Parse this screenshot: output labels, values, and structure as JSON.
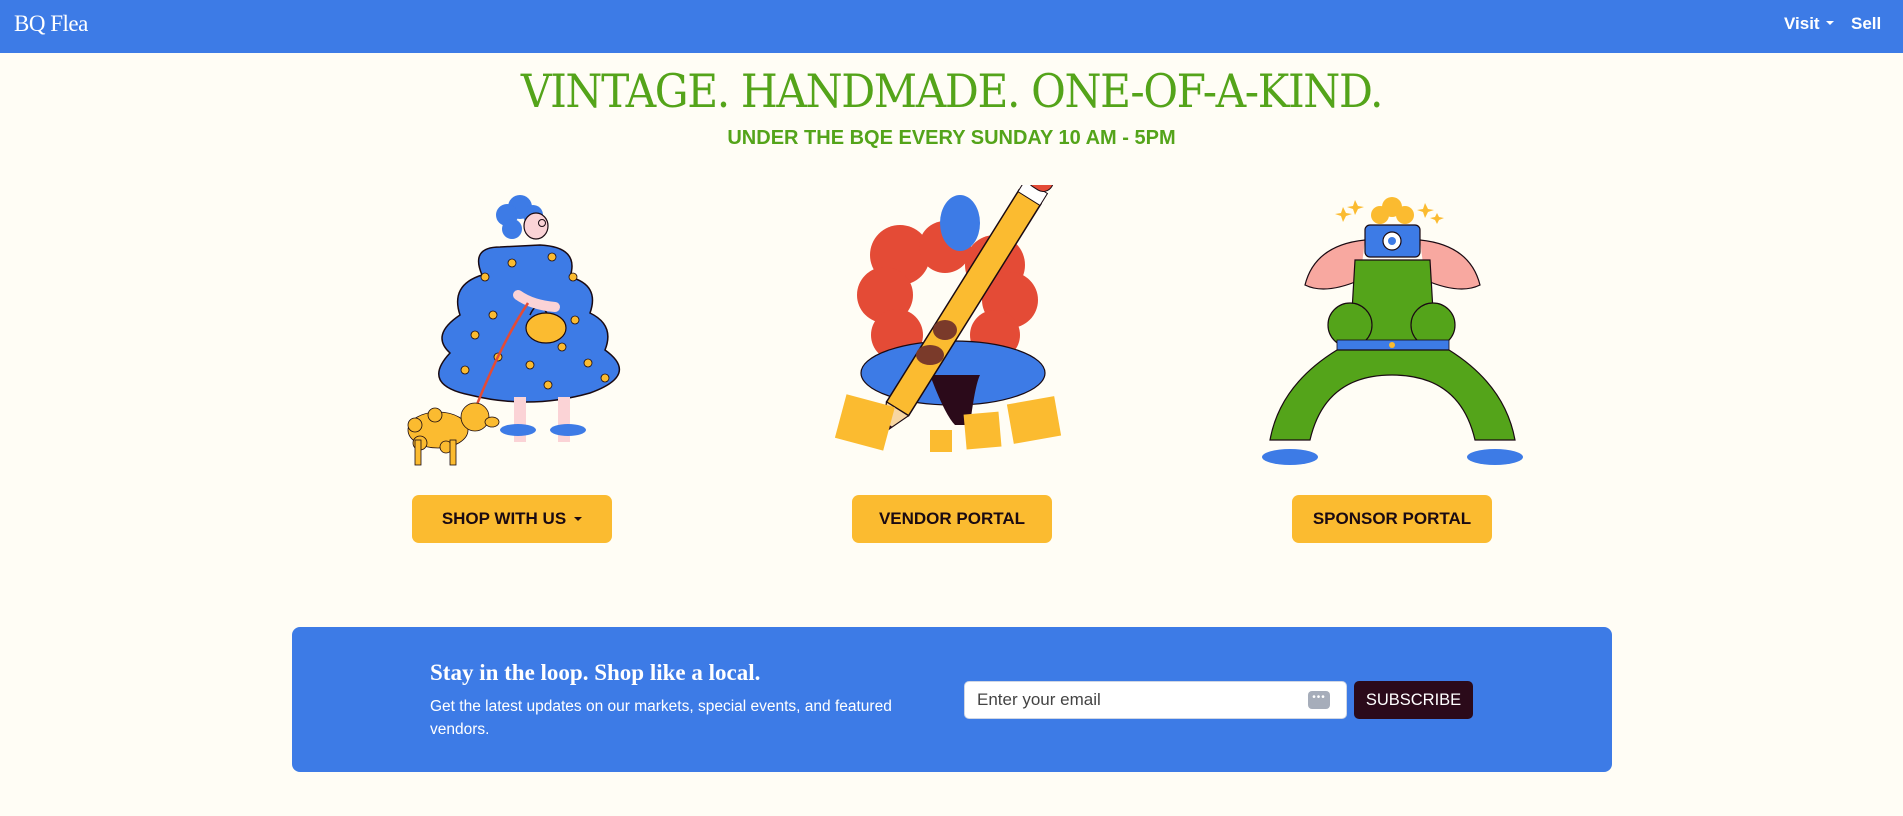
{
  "nav": {
    "logo": "BQ Flea",
    "visit_label": "Visit",
    "sell_label": "Sell"
  },
  "hero": {
    "headline": "VINTAGE. HANDMADE. ONE-OF-A-KIND.",
    "subline": "UNDER THE BQE EVERY SUNDAY 10 AM - 5PM"
  },
  "cards": [
    {
      "button_label": "SHOP WITH US",
      "illustration": "woman-walking-dog"
    },
    {
      "button_label": "VENDOR PORTAL",
      "illustration": "person-with-pencil"
    },
    {
      "button_label": "SPONSOR PORTAL",
      "illustration": "photographer-with-camera"
    }
  ],
  "newsletter": {
    "title": "Stay in the loop. Shop like a local.",
    "description": "Get the latest updates on our markets, special events, and featured vendors.",
    "email_placeholder": "Enter your email",
    "subscribe_label": "SUBSCRIBE"
  },
  "colors": {
    "nav_bg": "#3d7be6",
    "page_bg": "#fffdf5",
    "headline_green": "#54a41a",
    "button_yellow": "#fbbb30",
    "subscribe_bg": "#2b0a1a"
  }
}
